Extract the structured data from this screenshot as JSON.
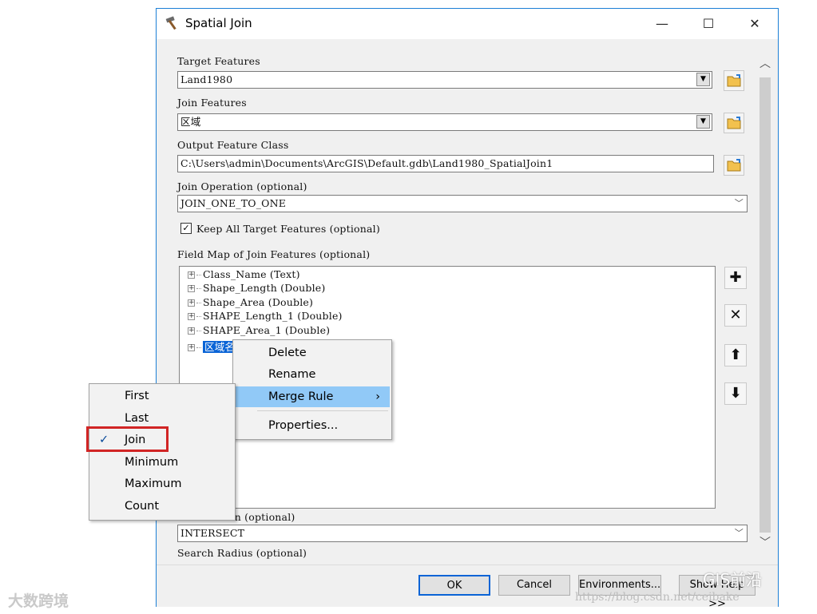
{
  "window": {
    "title": "Spatial Join",
    "minimize_glyph": "—",
    "maximize_glyph": "☐",
    "close_glyph": "✕"
  },
  "form": {
    "target_features": {
      "label": "Target Features",
      "value": "Land1980"
    },
    "join_features": {
      "label": "Join Features",
      "value": "区域"
    },
    "output_feature_class": {
      "label": "Output Feature Class",
      "value": "C:\\Users\\admin\\Documents\\ArcGIS\\Default.gdb\\Land1980_SpatialJoin1"
    },
    "join_operation": {
      "label": "Join Operation (optional)",
      "value": "JOIN_ONE_TO_ONE"
    },
    "keep_all": {
      "label": "Keep All Target Features (optional)",
      "checked": true
    },
    "field_map": {
      "label": "Field Map of Join Features (optional)",
      "items": [
        "Class_Name (Text)",
        "Shape_Length (Double)",
        "Shape_Area (Double)",
        "SHAPE_Length_1 (Double)",
        "SHAPE_Area_1 (Double)",
        "区域名称 (Text)"
      ],
      "selected_visible_text": "区域名"
    },
    "match_option": {
      "label_visible": "on (optional)",
      "value": "INTERSECT"
    },
    "search_radius": {
      "label": "Search Radius (optional)"
    }
  },
  "side_buttons": {
    "add": "✚",
    "remove": "✕",
    "up": "⬆",
    "down": "⬇"
  },
  "buttons": {
    "ok": "OK",
    "cancel": "Cancel",
    "environments": "Environments...",
    "show_help": "Show Help >>"
  },
  "context_menu": {
    "items": [
      "Delete",
      "Rename",
      "Merge Rule",
      "Properties..."
    ],
    "submenu_arrow": "›"
  },
  "merge_rule_menu": {
    "items": [
      "First",
      "Last",
      "Join",
      "Minimum",
      "Maximum",
      "Count"
    ],
    "checked": "Join",
    "check_glyph": "✓"
  },
  "watermarks": {
    "left": "大数跨境",
    "right": "GIS前沿",
    "url": "https://blog.csdn.net/ceibake"
  },
  "colors": {
    "selection": "#0a64d6",
    "menu_highlight": "#91c9f7",
    "highlight_box": "#d12525",
    "window_border": "#1c7fd6"
  }
}
